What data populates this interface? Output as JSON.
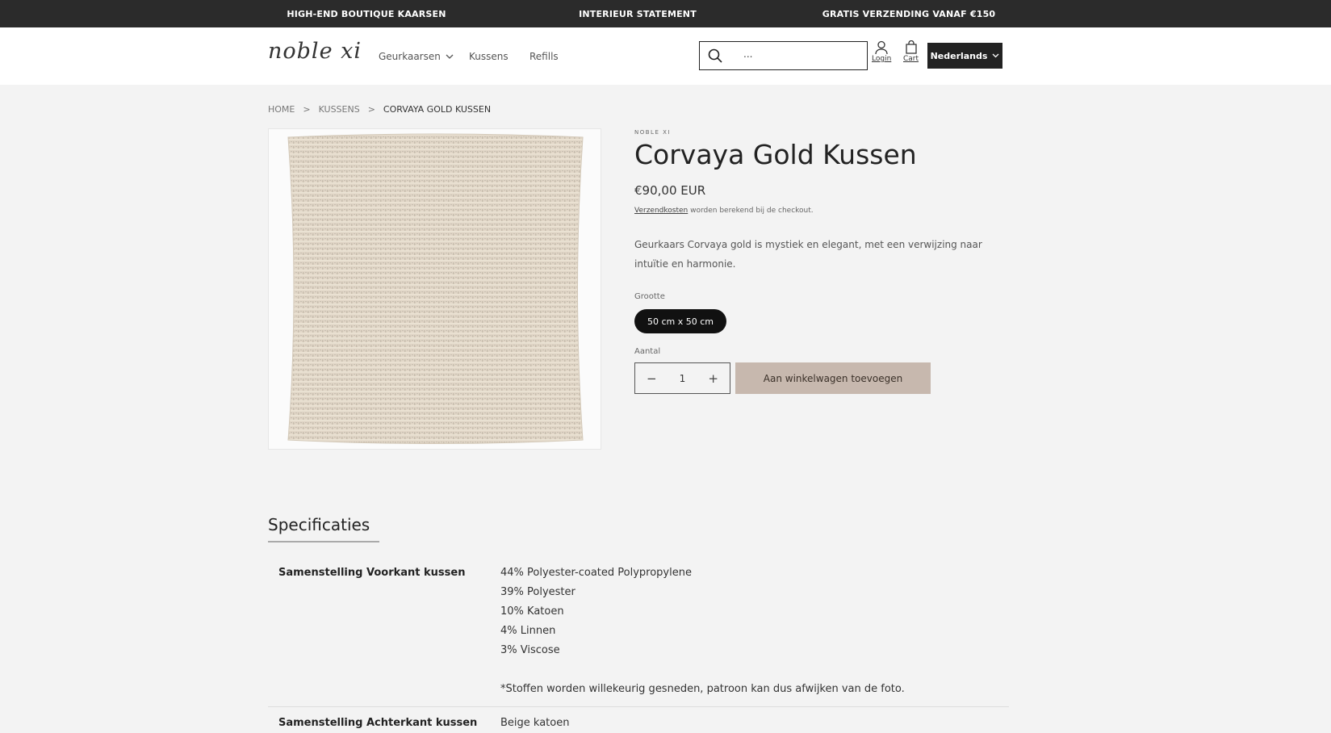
{
  "announcement": [
    "HIGH-END BOUTIQUE KAARSEN",
    "INTERIEUR STATEMENT",
    "GRATIS VERZENDING VANAF €150"
  ],
  "header": {
    "logo": "noble xi",
    "nav": [
      "Geurkaarsen",
      "Kussens",
      "Refills"
    ],
    "search_value": "...",
    "login_label": "Login",
    "cart_label": "Cart",
    "language": "Nederlands"
  },
  "breadcrumb": [
    "HOME",
    "KUSSENS",
    "CORVAYA GOLD KUSSEN"
  ],
  "product": {
    "vendor": "NOBLE XI",
    "title": "Corvaya Gold Kussen",
    "price": "€90,00 EUR",
    "shipping_link": "Verzendkosten",
    "shipping_text": " worden berekend bij de checkout.",
    "description": "Geurkaars Corvaya gold is mystiek en elegant, met een verwijzing naar intuïtie en harmonie.",
    "size_label": "Grootte",
    "size_value": "50 cm x 50 cm",
    "qty_label": "Aantal",
    "qty_value": "1",
    "add_to_cart": "Aan winkelwagen toevoegen"
  },
  "specs": {
    "title": "Specificaties",
    "front_key": "Samenstelling Voorkant kussen",
    "front_values": [
      "44% Polyester-coated Polypropylene",
      "39% Polyester",
      "10% Katoen",
      "4% Linnen",
      "3% Viscose"
    ],
    "front_note": "*Stoffen worden willekeurig gesneden, patroon kan dus afwijken van de foto.",
    "back_key": "Samenstelling Achterkant kussen",
    "back_value": "Beige katoen"
  },
  "colors": {
    "announcement_bg": "#2b2b2b",
    "button_bg": "#c7b8ae",
    "pill_bg": "#111111"
  }
}
